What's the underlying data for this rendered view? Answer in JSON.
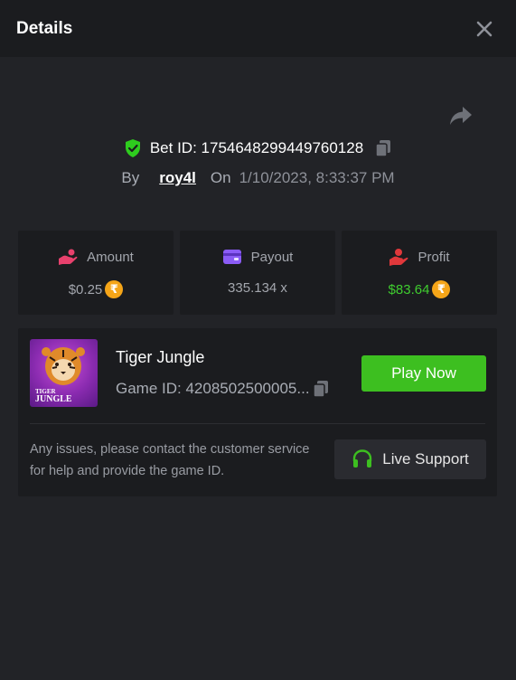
{
  "header": {
    "title": "Details"
  },
  "bet": {
    "id_label": "Bet ID:",
    "id_value": "1754648299449760128",
    "by_label": "By",
    "user": "roy4l",
    "on_label": "On",
    "date": "1/10/2023, 8:33:37 PM"
  },
  "stats": {
    "amount": {
      "label": "Amount",
      "value": "$0.25",
      "currency_symbol": "₹"
    },
    "payout": {
      "label": "Payout",
      "value": "335.134 x"
    },
    "profit": {
      "label": "Profit",
      "value": "$83.64",
      "currency_symbol": "₹"
    }
  },
  "game": {
    "name": "Tiger Jungle",
    "id_text": "Game ID: 4208502500005...",
    "thumb_title_line1": "TIGER",
    "thumb_title_line2": "JUNGLE",
    "play_label": "Play Now"
  },
  "support": {
    "text": "Any issues, please contact the customer service for help and provide the game ID.",
    "button_label": "Live Support"
  },
  "colors": {
    "accent_green": "#3dbf20",
    "profit_green": "#3fcc2f",
    "coin": "#f5a518",
    "amount_icon": "#e8416d",
    "payout_icon": "#8b5cf6",
    "profit_icon": "#e0383b"
  },
  "icons": {
    "close": "close-icon",
    "share": "share-icon",
    "shield": "shield-check-icon",
    "copy": "copy-icon",
    "amount": "hand-coin-icon",
    "payout": "wallet-icon",
    "profit": "profit-hand-icon",
    "support": "headset-icon"
  }
}
